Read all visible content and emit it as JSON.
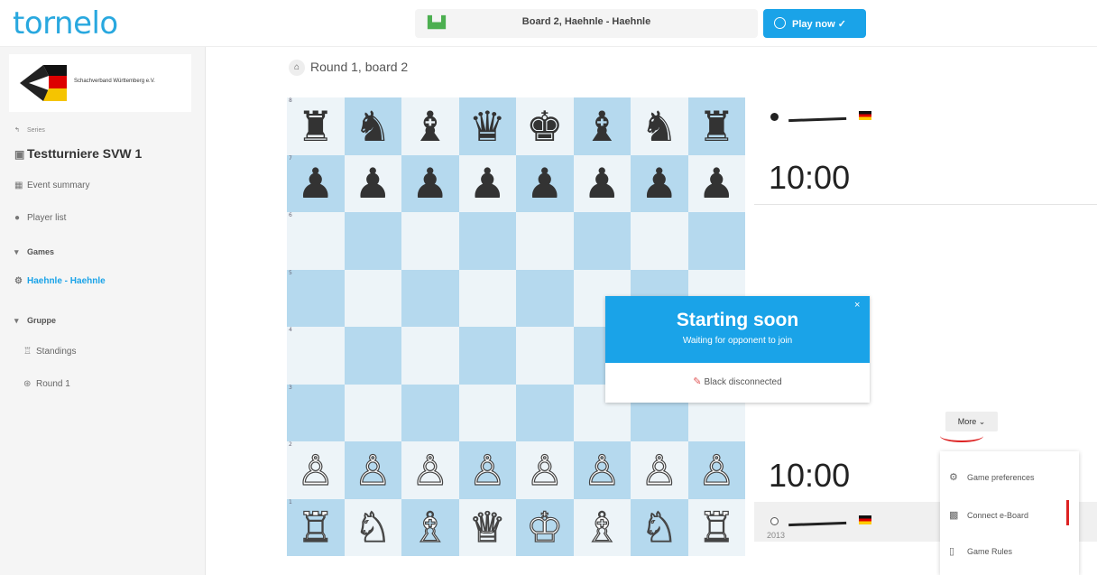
{
  "header": {
    "logo": "tornelo",
    "game_pill": "Board 2, Haehnle - Haehnle",
    "play_now": "Play now ✓"
  },
  "sidebar": {
    "org_name": "Schachverband Württemberg e.V.",
    "back_label": "Series",
    "tournament_title": "Testturniere SVW 1",
    "items": [
      {
        "label": "Event summary",
        "icon": "table-icon"
      },
      {
        "label": "Player list",
        "icon": "players-icon"
      }
    ],
    "games_heading": "Games",
    "games": [
      {
        "label": "Haehnle - Haehnle",
        "active": true
      }
    ],
    "group_heading": "Gruppe",
    "group_items": [
      {
        "label": "Standings",
        "icon": "trophy-icon"
      },
      {
        "label": "Round 1",
        "icon": "round-icon"
      }
    ]
  },
  "main": {
    "breadcrumb": "Round 1, board 2"
  },
  "board": {
    "rows": [
      [
        "♜",
        "♞",
        "♝",
        "♛",
        "♚",
        "♝",
        "♞",
        "♜"
      ],
      [
        "♟",
        "♟",
        "♟",
        "♟",
        "♟",
        "♟",
        "♟",
        "♟"
      ],
      [
        "",
        "",
        "",
        "",
        "",
        "",
        "",
        ""
      ],
      [
        "",
        "",
        "",
        "",
        "",
        "",
        "",
        ""
      ],
      [
        "",
        "",
        "",
        "",
        "",
        "",
        "",
        ""
      ],
      [
        "",
        "",
        "",
        "",
        "",
        "",
        "",
        ""
      ],
      [
        "♙",
        "♙",
        "♙",
        "♙",
        "♙",
        "♙",
        "♙",
        "♙"
      ],
      [
        "♖",
        "♘",
        "♗",
        "♕",
        "♔",
        "♗",
        "♘",
        "♖"
      ]
    ],
    "ranks": [
      "8",
      "7",
      "6",
      "5",
      "4",
      "3",
      "2",
      "1"
    ]
  },
  "players": {
    "top": {
      "color": "black",
      "clock": "10:00"
    },
    "bottom": {
      "color": "white",
      "clock": "10:00",
      "rating": "2013"
    }
  },
  "modal": {
    "title": "Starting soon",
    "subtitle": "Waiting for opponent to join",
    "close": "×",
    "status": "Black disconnected"
  },
  "more_menu": {
    "button": "More ⌄",
    "items": [
      {
        "label": "Game preferences",
        "icon": "preferences-icon"
      },
      {
        "label": "Connect e-Board",
        "icon": "eboard-icon"
      },
      {
        "label": "Game Rules",
        "icon": "rules-icon"
      }
    ]
  },
  "colors": {
    "accent": "#1aa3e8",
    "board_dark": "#b5d9ee",
    "board_light": "#edf4f8"
  }
}
